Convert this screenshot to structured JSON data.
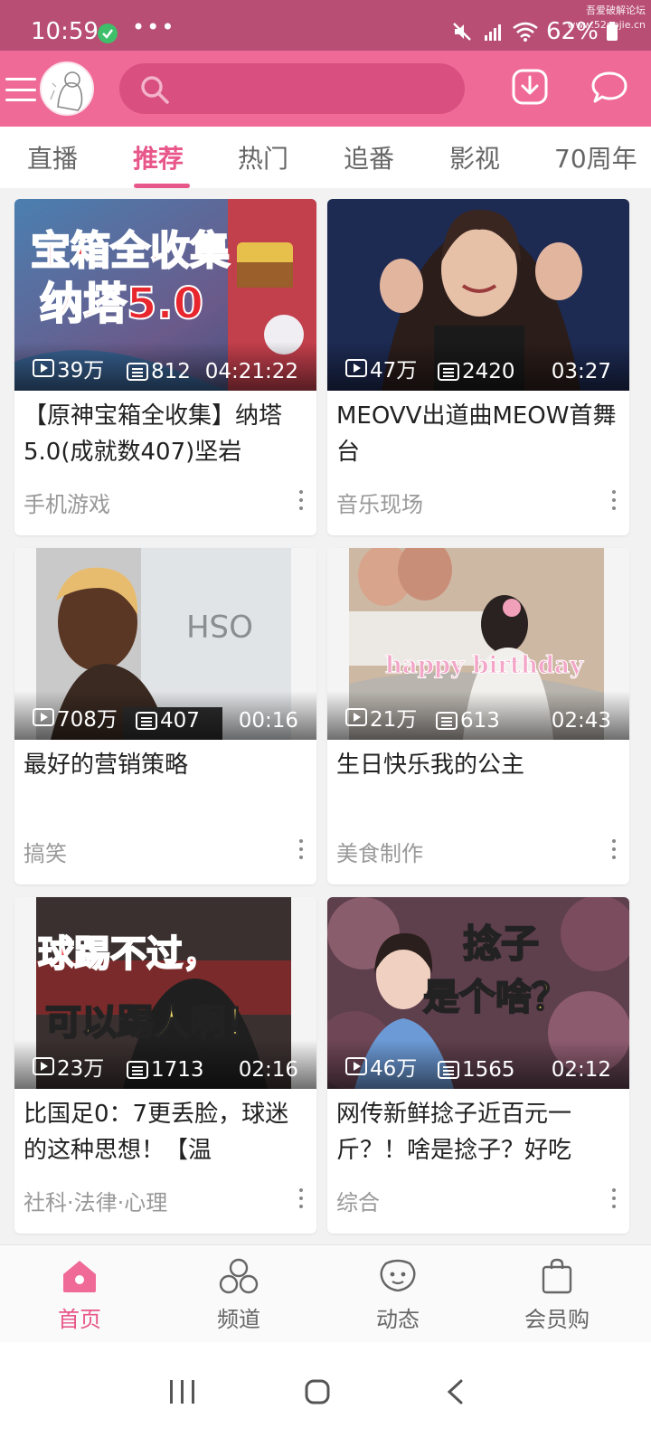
{
  "status_bar": {
    "time": "10:59",
    "more": "•••",
    "battery": "62%",
    "watermark_line1": "吾爱破解论坛",
    "watermark_line2": "www.52pojie.cn"
  },
  "app_bar": {
    "search_placeholder": "",
    "icons": [
      "menu-icon",
      "avatar",
      "search-icon",
      "download-icon",
      "message-icon"
    ]
  },
  "tabs": [
    {
      "label": "直播",
      "active": false
    },
    {
      "label": "推荐",
      "active": true
    },
    {
      "label": "热门",
      "active": false
    },
    {
      "label": "追番",
      "active": false
    },
    {
      "label": "影视",
      "active": false
    },
    {
      "label": "70周年",
      "active": false
    }
  ],
  "feed": [
    {
      "thumb_text": "宝箱全收集\n纳塔5.0",
      "views": "39万",
      "danmaku": "812",
      "duration": "04:21:22",
      "title": "【原神宝箱全收集】纳塔5.0(成就数407)坚岩",
      "category": "手机游戏"
    },
    {
      "thumb_text": "",
      "views": "47万",
      "danmaku": "2420",
      "duration": "03:27",
      "title": "MEOVV出道曲MEOW首舞台",
      "category": "音乐现场"
    },
    {
      "thumb_text": "",
      "views": "708万",
      "danmaku": "407",
      "duration": "00:16",
      "title": "最好的营销策略",
      "category": "搞笑"
    },
    {
      "thumb_text": "happy birthday",
      "views": "21万",
      "danmaku": "613",
      "duration": "02:43",
      "title": "生日快乐我的公主",
      "category": "美食制作"
    },
    {
      "thumb_text": "球踢不过，\n可以踢人啊！",
      "views": "23万",
      "danmaku": "1713",
      "duration": "02:16",
      "title": "比国足0：7更丢脸，球迷的这种思想！【温",
      "category": "社科·法律·心理"
    },
    {
      "thumb_text": "捻子\n是个啥？",
      "views": "46万",
      "danmaku": "1565",
      "duration": "02:12",
      "title": "网传新鲜捻子近百元一斤？！啥是捻子？好吃",
      "category": "综合"
    }
  ],
  "bottom_nav": [
    {
      "label": "首页",
      "icon": "home-icon",
      "active": true
    },
    {
      "label": "频道",
      "icon": "channel-icon",
      "active": false
    },
    {
      "label": "动态",
      "icon": "moments-icon",
      "active": false
    },
    {
      "label": "会员购",
      "icon": "shopping-bag-icon",
      "active": false
    }
  ],
  "colors": {
    "status_bar": "#b84e73",
    "app_bar": "#f06a98",
    "accent": "#e8578a"
  }
}
